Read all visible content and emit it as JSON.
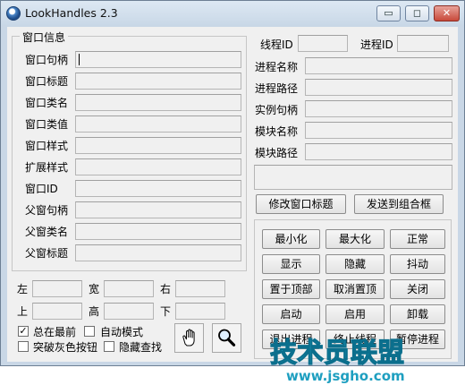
{
  "window": {
    "title": "LookHandles 2.3",
    "min_glyph": "▭",
    "max_glyph": "◻",
    "close_glyph": "✕"
  },
  "window_info": {
    "group_title": "窗口信息",
    "labels": [
      "窗口句柄",
      "窗口标题",
      "窗口类名",
      "窗口类值",
      "窗口样式",
      "扩展样式",
      "窗口ID",
      "父窗句柄",
      "父窗类名",
      "父窗标题"
    ]
  },
  "process_info": {
    "thread_id_label": "线程ID",
    "process_id_label": "进程ID",
    "labels": [
      "进程名称",
      "进程路径",
      "实例句柄",
      "模块名称",
      "模块路径"
    ]
  },
  "actions": {
    "modify_title": "修改窗口标题",
    "send_combo": "发送到组合框"
  },
  "control_buttons": [
    [
      "最小化",
      "最大化",
      "正常"
    ],
    [
      "显示",
      "隐藏",
      "抖动"
    ],
    [
      "置于顶部",
      "取消置顶",
      "关闭"
    ],
    [
      "启动",
      "启用",
      "卸载"
    ],
    [
      "退出进程",
      "终止线程",
      "暂停进程"
    ]
  ],
  "position": {
    "left": "左",
    "width": "宽",
    "right": "右",
    "top": "上",
    "height": "高",
    "bottom": "下"
  },
  "options": {
    "always_on_top": {
      "label": "总在最前",
      "checked": true
    },
    "auto_mode": {
      "label": "自动模式",
      "checked": false
    },
    "break_gray": {
      "label": "突破灰色按钮",
      "checked": false
    },
    "hide_search": {
      "label": "隐藏查找",
      "checked": false
    }
  },
  "tools": {
    "hand_icon": "hand-icon",
    "magnifier_icon": "magnifier-icon"
  },
  "watermark": {
    "brand": "技术员联盟",
    "url": "www.jsgho.com"
  }
}
